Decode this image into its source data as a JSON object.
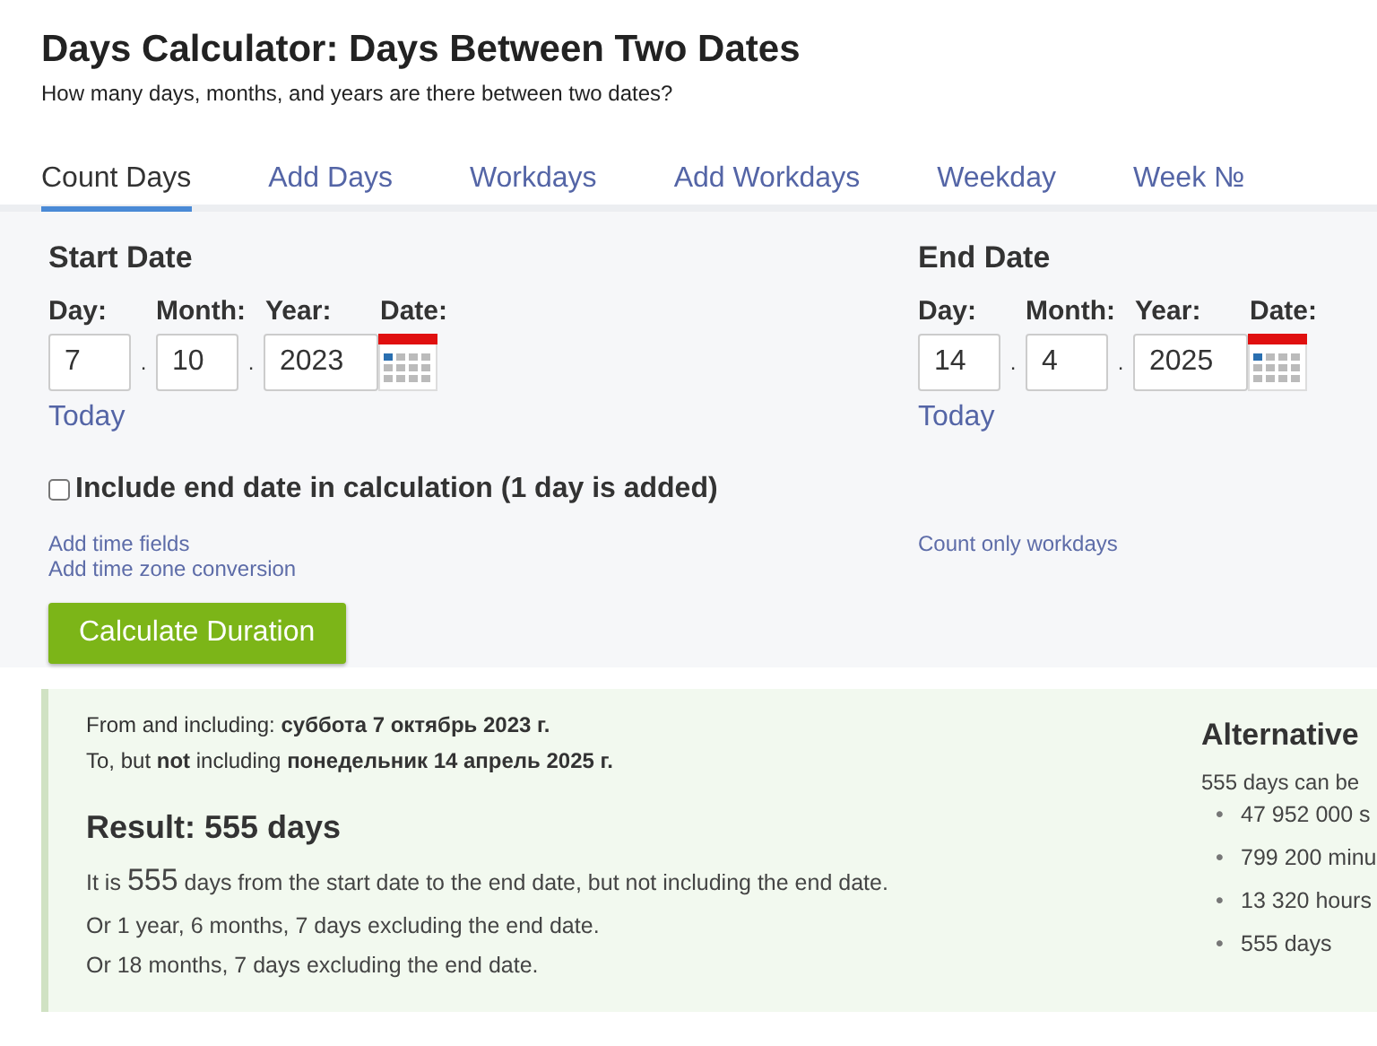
{
  "title": "Days Calculator: Days Between Two Dates",
  "subtitle": "How many days, months, and years are there between two dates?",
  "tabs": [
    {
      "label": "Count Days",
      "selected": true
    },
    {
      "label": "Add Days",
      "selected": false
    },
    {
      "label": "Workdays",
      "selected": false
    },
    {
      "label": "Add Workdays",
      "selected": false
    },
    {
      "label": "Weekday",
      "selected": false
    },
    {
      "label": "Week №",
      "selected": false
    }
  ],
  "dates": [
    {
      "heading": "Start Date",
      "day_label": "Day:",
      "month_label": "Month:",
      "year_label": "Year:",
      "date_label": "Date:",
      "day": "7",
      "month": "10",
      "year": "2023",
      "today": "Today",
      "links": [
        "Add time fields",
        "Add time zone conversion"
      ]
    },
    {
      "heading": "End Date",
      "day_label": "Day:",
      "month_label": "Month:",
      "year_label": "Year:",
      "date_label": "Date:",
      "day": "14",
      "month": "4",
      "year": "2025",
      "today": "Today",
      "links": [
        "Count only workdays"
      ]
    }
  ],
  "include_end": {
    "label": "Include end date in calculation (1 day is added)",
    "checked": false
  },
  "calculate_button": "Calculate Duration",
  "result": {
    "from": "From and including: **суббота 7 октябрь 2023 г.**",
    "to": "To, but **not** including **понедельник 14 апрель 2025 г.**",
    "heading": "Result: 555 days",
    "sentence": {
      "prefix": "It is",
      "number": "555",
      "suffix": "days from the start date to the end date, but not including the end date."
    },
    "lines": [
      "Or 1 year, 6 months, 7 days excluding the end date.",
      "Or 18 months, 7 days excluding the end date."
    ]
  },
  "alternative": {
    "heading": "Alternative",
    "intro": "555 days can be",
    "items": [
      {
        "marker": "•",
        "text": "47 952 000 s"
      },
      {
        "marker": "•",
        "text": "799 200 minu"
      },
      {
        "marker": "•",
        "text": "13 320 hours"
      },
      {
        "marker": "•",
        "text": "555 days"
      }
    ]
  },
  "separator": "."
}
